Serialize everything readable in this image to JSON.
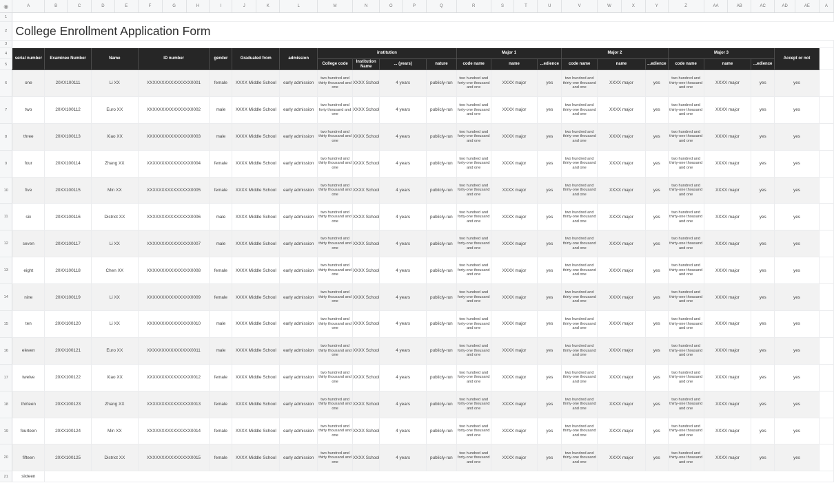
{
  "sheet": {
    "corner_icon": "eye-icon",
    "column_letters": [
      "A",
      "B",
      "C",
      "D",
      "E",
      "F",
      "G",
      "H",
      "I",
      "J",
      "K",
      "L",
      "M",
      "N",
      "O",
      "P",
      "Q",
      "R",
      "S",
      "T",
      "U",
      "V",
      "W",
      "X",
      "Y",
      "Z",
      "AA",
      "AB",
      "AC",
      "AD",
      "AE",
      "A"
    ],
    "title": "College Enrollment Application Form",
    "header_row_numbers": [
      "1",
      "2",
      "3",
      "4",
      "5"
    ],
    "last_row_number": "21",
    "last_row_label": "sixteen"
  },
  "headers": {
    "serial_number": "serial number",
    "examinee_number": "Examinee Number",
    "name": "Name",
    "id_number": "ID number",
    "gender": "gender",
    "graduated_from": "Graduated from",
    "admission": "admission",
    "institution": "institution",
    "college_code": "College code",
    "institution_name": "Institution Name",
    "years": "... (years)",
    "nature": "nature",
    "major1": "Major 1",
    "major2": "Major 2",
    "major3": "Major 3",
    "code_name": "code name",
    "name_sub": "name",
    "obedience": "...edience",
    "accept": "Accept or not"
  },
  "rows": [
    {
      "rownum": "6",
      "serial": "one",
      "exam": "20XX100111",
      "name": "Li XX",
      "id": "XXXXXXXXXXXXXXX0001",
      "gender": "female",
      "school": "XXXX Middle School",
      "admission": "early admission",
      "college_code": "two hundred and thirty thousand and one",
      "inst_name": "XXXX School",
      "years": "4 years",
      "nature": "publicly-run",
      "m1_code": "two hundred and forty-one thousand and one",
      "m1_name": "XXXX major",
      "m1_ob": "yes",
      "m2_code": "two hundred and thirty-one thousand and one",
      "m2_name": "XXXX major",
      "m2_ob": "yes",
      "m3_code": "two hundred and thirty-one thousand and one",
      "m3_name": "XXXX major",
      "m3_ob": "yes",
      "accept": "yes"
    },
    {
      "rownum": "7",
      "serial": "two",
      "exam": "20XX100112",
      "name": "Euro XX",
      "id": "XXXXXXXXXXXXXXX0002",
      "gender": "male",
      "school": "XXXX Middle School",
      "admission": "early admission",
      "college_code": "two hundred and forty thousand and one",
      "inst_name": "XXXX School",
      "years": "4 years",
      "nature": "publicly-run",
      "m1_code": "two hundred and forty-one thousand and one",
      "m1_name": "XXXX major",
      "m1_ob": "yes",
      "m2_code": "two hundred and thirty-one thousand and one",
      "m2_name": "XXXX major",
      "m2_ob": "yes",
      "m3_code": "two hundred and thirty-one thousand and one",
      "m3_name": "XXXX major",
      "m3_ob": "yes",
      "accept": "yes"
    },
    {
      "rownum": "8",
      "serial": "three",
      "exam": "20XX100113",
      "name": "Xiao XX",
      "id": "XXXXXXXXXXXXXXX0003",
      "gender": "male",
      "school": "XXXX Middle School",
      "admission": "early admission",
      "college_code": "two hundred and thirty thousand and one",
      "inst_name": "XXXX School",
      "years": "4 years",
      "nature": "publicly-run",
      "m1_code": "two hundred and forty-one thousand and one",
      "m1_name": "XXXX major",
      "m1_ob": "yes",
      "m2_code": "two hundred and thirty-one thousand and one",
      "m2_name": "XXXX major",
      "m2_ob": "yes",
      "m3_code": "two hundred and thirty-one thousand and one",
      "m3_name": "XXXX major",
      "m3_ob": "yes",
      "accept": "yes"
    },
    {
      "rownum": "9",
      "serial": "four",
      "exam": "20XX100114",
      "name": "Zhang XX",
      "id": "XXXXXXXXXXXXXXX0004",
      "gender": "female",
      "school": "XXXX Middle School",
      "admission": "early admission",
      "college_code": "two hundred and thirty thousand and one",
      "inst_name": "XXXX School",
      "years": "4 years",
      "nature": "publicly-run",
      "m1_code": "two hundred and forty-one thousand and one",
      "m1_name": "XXXX major",
      "m1_ob": "yes",
      "m2_code": "two hundred and thirty-one thousand and one",
      "m2_name": "XXXX major",
      "m2_ob": "yes",
      "m3_code": "two hundred and thirty-one thousand and one",
      "m3_name": "XXXX major",
      "m3_ob": "yes",
      "accept": "yes"
    },
    {
      "rownum": "10",
      "serial": "five",
      "exam": "20XX100115",
      "name": "Min XX",
      "id": "XXXXXXXXXXXXXXX0005",
      "gender": "female",
      "school": "XXXX Middle School",
      "admission": "early admission",
      "college_code": "two hundred and thirty thousand and one",
      "inst_name": "XXXX School",
      "years": "4 years",
      "nature": "publicly-run",
      "m1_code": "two hundred and forty-one thousand and one",
      "m1_name": "XXXX major",
      "m1_ob": "yes",
      "m2_code": "two hundred and thirty-one thousand and one",
      "m2_name": "XXXX major",
      "m2_ob": "yes",
      "m3_code": "two hundred and thirty-one thousand and one",
      "m3_name": "XXXX major",
      "m3_ob": "yes",
      "accept": "yes"
    },
    {
      "rownum": "11",
      "serial": "six",
      "exam": "20XX100116",
      "name": "District XX",
      "id": "XXXXXXXXXXXXXXX0006",
      "gender": "male",
      "school": "XXXX Middle School",
      "admission": "early admission",
      "college_code": "two hundred and thirty thousand and one",
      "inst_name": "XXXX School",
      "years": "4 years",
      "nature": "publicly-run",
      "m1_code": "two hundred and forty-one thousand and one",
      "m1_name": "XXXX major",
      "m1_ob": "yes",
      "m2_code": "two hundred and thirty-one thousand and one",
      "m2_name": "XXXX major",
      "m2_ob": "yes",
      "m3_code": "two hundred and thirty-one thousand and one",
      "m3_name": "XXXX major",
      "m3_ob": "yes",
      "accept": "yes"
    },
    {
      "rownum": "12",
      "serial": "seven",
      "exam": "20XX100117",
      "name": "Li XX",
      "id": "XXXXXXXXXXXXXXX0007",
      "gender": "male",
      "school": "XXXX Middle School",
      "admission": "early admission",
      "college_code": "two hundred and thirty thousand and one",
      "inst_name": "XXXX School",
      "years": "4 years",
      "nature": "publicly-run",
      "m1_code": "two hundred and forty-one thousand and one",
      "m1_name": "XXXX major",
      "m1_ob": "yes",
      "m2_code": "two hundred and thirty-one thousand and one",
      "m2_name": "XXXX major",
      "m2_ob": "yes",
      "m3_code": "two hundred and thirty-one thousand and one",
      "m3_name": "XXXX major",
      "m3_ob": "yes",
      "accept": "yes"
    },
    {
      "rownum": "13",
      "serial": "eight",
      "exam": "20XX100118",
      "name": "Chen XX",
      "id": "XXXXXXXXXXXXXXX0008",
      "gender": "female",
      "school": "XXXX Middle School",
      "admission": "early admission",
      "college_code": "two hundred and thirty thousand and one",
      "inst_name": "XXXX School",
      "years": "4 years",
      "nature": "publicly-run",
      "m1_code": "two hundred and forty-one thousand and one",
      "m1_name": "XXXX major",
      "m1_ob": "yes",
      "m2_code": "two hundred and thirty-one thousand and one",
      "m2_name": "XXXX major",
      "m2_ob": "yes",
      "m3_code": "two hundred and thirty-one thousand and one",
      "m3_name": "XXXX major",
      "m3_ob": "yes",
      "accept": "yes"
    },
    {
      "rownum": "14",
      "serial": "nine",
      "exam": "20XX100119",
      "name": "Li XX",
      "id": "XXXXXXXXXXXXXXX0009",
      "gender": "female",
      "school": "XXXX Middle School",
      "admission": "early admission",
      "college_code": "two hundred and thirty thousand and one",
      "inst_name": "XXXX School",
      "years": "4 years",
      "nature": "publicly-run",
      "m1_code": "two hundred and forty-one thousand and one",
      "m1_name": "XXXX major",
      "m1_ob": "yes",
      "m2_code": "two hundred and thirty-one thousand and one",
      "m2_name": "XXXX major",
      "m2_ob": "yes",
      "m3_code": "two hundred and thirty-one thousand and one",
      "m3_name": "XXXX major",
      "m3_ob": "yes",
      "accept": "yes"
    },
    {
      "rownum": "15",
      "serial": "ten",
      "exam": "20XX100120",
      "name": "Li XX",
      "id": "XXXXXXXXXXXXXXX0010",
      "gender": "male",
      "school": "XXXX Middle School",
      "admission": "early admission",
      "college_code": "two hundred and thirty thousand and one",
      "inst_name": "XXXX School",
      "years": "4 years",
      "nature": "publicly-run",
      "m1_code": "two hundred and forty-one thousand and one",
      "m1_name": "XXXX major",
      "m1_ob": "yes",
      "m2_code": "two hundred and thirty-one thousand and one",
      "m2_name": "XXXX major",
      "m2_ob": "yes",
      "m3_code": "two hundred and thirty-one thousand and one",
      "m3_name": "XXXX major",
      "m3_ob": "yes",
      "accept": "yes"
    },
    {
      "rownum": "16",
      "serial": "eleven",
      "exam": "20XX100121",
      "name": "Euro XX",
      "id": "XXXXXXXXXXXXXXX0011",
      "gender": "male",
      "school": "XXXX Middle School",
      "admission": "early admission",
      "college_code": "two hundred and thirty thousand and one",
      "inst_name": "XXXX School",
      "years": "4 years",
      "nature": "publicly-run",
      "m1_code": "two hundred and forty-one thousand and one",
      "m1_name": "XXXX major",
      "m1_ob": "yes",
      "m2_code": "two hundred and thirty-one thousand and one",
      "m2_name": "XXXX major",
      "m2_ob": "yes",
      "m3_code": "two hundred and thirty-one thousand and one",
      "m3_name": "XXXX major",
      "m3_ob": "yes",
      "accept": "yes"
    },
    {
      "rownum": "17",
      "serial": "twelve",
      "exam": "20XX100122",
      "name": "Xiao XX",
      "id": "XXXXXXXXXXXXXXX0012",
      "gender": "female",
      "school": "XXXX Middle School",
      "admission": "early admission",
      "college_code": "two hundred and thirty thousand and one",
      "inst_name": "XXXX School",
      "years": "4 years",
      "nature": "publicly-run",
      "m1_code": "two hundred and forty-one thousand and one",
      "m1_name": "XXXX major",
      "m1_ob": "yes",
      "m2_code": "two hundred and thirty-one thousand and one",
      "m2_name": "XXXX major",
      "m2_ob": "yes",
      "m3_code": "two hundred and thirty-one thousand and one",
      "m3_name": "XXXX major",
      "m3_ob": "yes",
      "accept": "yes"
    },
    {
      "rownum": "18",
      "serial": "thirteen",
      "exam": "20XX100123",
      "name": "Zhang XX",
      "id": "XXXXXXXXXXXXXXX0013",
      "gender": "female",
      "school": "XXXX Middle School",
      "admission": "early admission",
      "college_code": "two hundred and thirty thousand and one",
      "inst_name": "XXXX School",
      "years": "4 years",
      "nature": "publicly-run",
      "m1_code": "two hundred and forty-one thousand and one",
      "m1_name": "XXXX major",
      "m1_ob": "yes",
      "m2_code": "two hundred and thirty-one thousand and one",
      "m2_name": "XXXX major",
      "m2_ob": "yes",
      "m3_code": "two hundred and thirty-one thousand and one",
      "m3_name": "XXXX major",
      "m3_ob": "yes",
      "accept": "yes"
    },
    {
      "rownum": "19",
      "serial": "fourteen",
      "exam": "20XX100124",
      "name": "Min XX",
      "id": "XXXXXXXXXXXXXXX0014",
      "gender": "female",
      "school": "XXXX Middle School",
      "admission": "early admission",
      "college_code": "two hundred and thirty thousand and one",
      "inst_name": "XXXX School",
      "years": "4 years",
      "nature": "publicly-run",
      "m1_code": "two hundred and forty-one thousand and one",
      "m1_name": "XXXX major",
      "m1_ob": "yes",
      "m2_code": "two hundred and thirty-one thousand and one",
      "m2_name": "XXXX major",
      "m2_ob": "yes",
      "m3_code": "two hundred and thirty-one thousand and one",
      "m3_name": "XXXX major",
      "m3_ob": "yes",
      "accept": "yes"
    },
    {
      "rownum": "20",
      "serial": "fifteen",
      "exam": "20XX100125",
      "name": "District XX",
      "id": "XXXXXXXXXXXXXXX0015",
      "gender": "female",
      "school": "XXXX Middle School",
      "admission": "early admission",
      "college_code": "two hundred and thirty thousand and one",
      "inst_name": "XXXX School",
      "years": "4 years",
      "nature": "publicly-run",
      "m1_code": "two hundred and forty-one thousand and one",
      "m1_name": "XXXX major",
      "m1_ob": "yes",
      "m2_code": "two hundred and thirty-one thousand and one",
      "m2_name": "XXXX major",
      "m2_ob": "yes",
      "m3_code": "two hundred and thirty-one thousand and one",
      "m3_name": "XXXX major",
      "m3_ob": "yes",
      "accept": "yes"
    }
  ]
}
